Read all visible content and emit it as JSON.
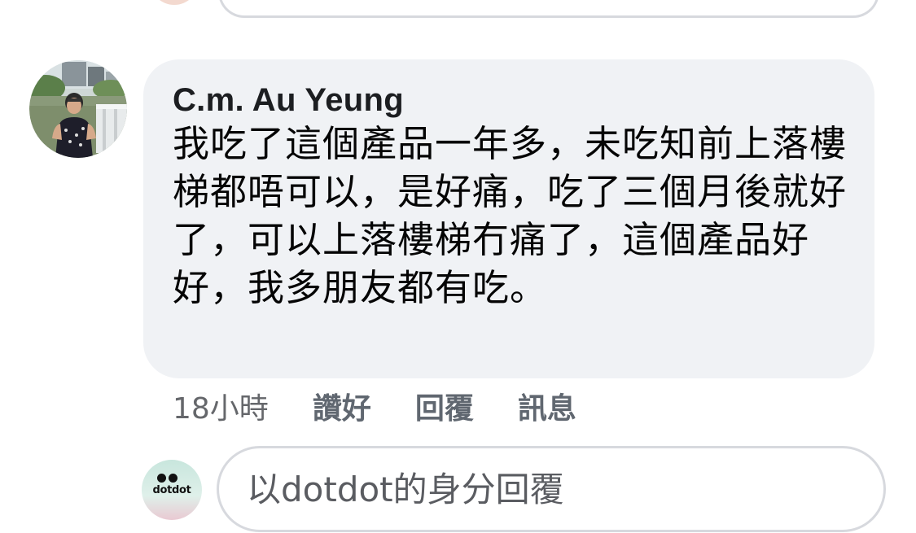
{
  "comment": {
    "author": "C.m. Au Yeung",
    "text": "我吃了這個產品一年多，未吃知前上落樓梯都唔可以，是好痛，吃了三個月後就好了，可以上落樓梯冇痛了，這個產品好好，我多朋友都有吃。",
    "time": "18小時",
    "actions": {
      "like": "讚好",
      "reply": "回覆",
      "message": "訊息"
    }
  },
  "reply": {
    "avatar_logo": "dotdot",
    "placeholder": "以dotdot的身分回覆"
  },
  "colors": {
    "bubble": "#f0f2f5",
    "secondary_text": "#65676b",
    "input_border": "#d7d9de"
  }
}
